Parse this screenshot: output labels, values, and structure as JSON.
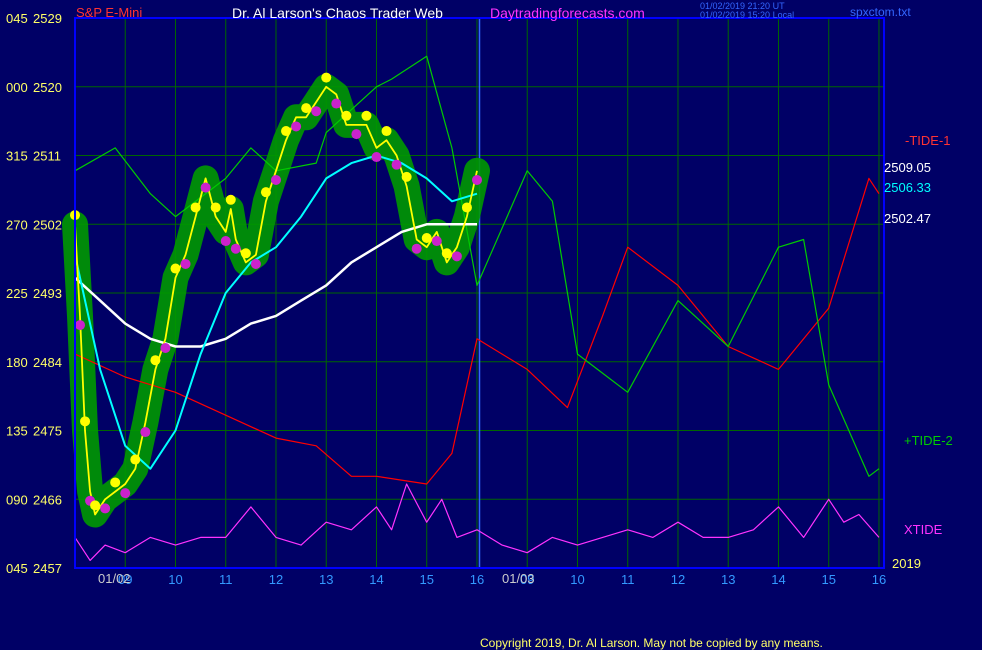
{
  "header": {
    "symbol": "S&P E-Mini",
    "title": "Dr. Al Larson's Chaos Trader Web",
    "site": "Daytradingforecasts.com",
    "timestamp1": "01/02/2019 21:20 UT",
    "timestamp2": "01/02/2019 15:20 Local",
    "filename": "spxctom.txt"
  },
  "footer": {
    "copyright": "Copyright 2019, Dr. Al Larson. May not be copied by any means.",
    "year": "2019"
  },
  "colors": {
    "background": "#000066",
    "grid": "#006600",
    "frame": "#0000ff",
    "price": "#ffff00",
    "ema_cyan": "#00ffff",
    "ema_white": "#ffffff",
    "tide1": "#ff0000",
    "tide2": "#00cc00",
    "xtide": "#ff33ff",
    "ribbon": "#009900"
  },
  "chart_data": {
    "type": "line",
    "xlabel": "",
    "ylabel": "",
    "date_labels": [
      "01/02",
      "01/03"
    ],
    "x_ticks": [
      "09",
      "10",
      "11",
      "12",
      "13",
      "14",
      "15",
      "16",
      "09",
      "10",
      "11",
      "12",
      "13",
      "14",
      "15",
      "16"
    ],
    "hours_x": [
      9,
      10,
      11,
      12,
      13,
      14,
      15,
      16,
      17,
      18,
      19,
      20,
      21,
      22,
      23,
      24
    ],
    "y_ticks_price": [
      2457,
      2466,
      2475,
      2484,
      2493,
      2502,
      2511,
      2520,
      2529
    ],
    "y_ticks_left": [
      "045",
      "090",
      "135",
      "180",
      "225",
      "270",
      "315",
      "000",
      "045"
    ],
    "ylim": [
      2457,
      2529
    ],
    "xlim": [
      8.0,
      24.1
    ],
    "right_labels": {
      "price_last": "2509.05",
      "ema_fast_last": "2506.33",
      "ema_slow_last": "2502.47",
      "tide1": "-TIDE-1",
      "tide2": "+TIDE-2",
      "xtide": "XTIDE"
    },
    "series": [
      {
        "name": "price",
        "x": [
          8.0,
          8.1,
          8.2,
          8.3,
          8.4,
          8.6,
          8.8,
          9.0,
          9.2,
          9.4,
          9.6,
          9.8,
          10.0,
          10.2,
          10.4,
          10.6,
          10.8,
          11.0,
          11.1,
          11.2,
          11.4,
          11.6,
          11.8,
          12.0,
          12.2,
          12.4,
          12.6,
          12.8,
          13.0,
          13.2,
          13.4,
          13.6,
          13.8,
          14.0,
          14.2,
          14.4,
          14.6,
          14.8,
          15.0,
          15.2,
          15.4,
          15.6,
          15.8,
          16.0
        ],
        "values": [
          2502,
          2490,
          2475,
          2467,
          2464,
          2466,
          2467,
          2468,
          2470,
          2476,
          2483,
          2487,
          2495,
          2498,
          2503,
          2508,
          2503,
          2501,
          2504,
          2500,
          2497,
          2498,
          2505,
          2509,
          2513,
          2516,
          2516,
          2518,
          2520,
          2519,
          2515,
          2515,
          2515,
          2512,
          2513,
          2511,
          2507,
          2500,
          2499,
          2501,
          2497,
          2499,
          2503,
          2509
        ]
      },
      {
        "name": "ema_fast",
        "x": [
          8.0,
          8.5,
          9.0,
          9.5,
          10.0,
          10.5,
          11.0,
          11.5,
          12.0,
          12.5,
          13.0,
          13.5,
          14.0,
          14.5,
          15.0,
          15.5,
          16.0
        ],
        "values": [
          2498,
          2483,
          2473,
          2470,
          2475,
          2485,
          2493,
          2497,
          2499,
          2503,
          2508,
          2510,
          2511,
          2510,
          2508,
          2505,
          2506
        ]
      },
      {
        "name": "ema_slow",
        "x": [
          8.0,
          8.5,
          9.0,
          9.5,
          10.0,
          10.5,
          11.0,
          11.5,
          12.0,
          12.5,
          13.0,
          13.5,
          14.0,
          14.5,
          15.0,
          15.5,
          16.0
        ],
        "values": [
          2495,
          2492,
          2489,
          2487,
          2486,
          2486,
          2487,
          2489,
          2490,
          2492,
          2494,
          2497,
          2499,
          2501,
          2502,
          2502,
          2502
        ]
      },
      {
        "name": "TIDE-1",
        "x": [
          8.0,
          9.0,
          10.0,
          11.0,
          12.0,
          12.8,
          13.5,
          14.0,
          15.0,
          15.5,
          16.0,
          17.0,
          17.8,
          18.5,
          19.0,
          20.0,
          21.0,
          22.0,
          23.0,
          23.8,
          24.0
        ],
        "values": [
          2485,
          2482,
          2480,
          2477,
          2474,
          2473,
          2469,
          2469,
          2468,
          2472,
          2487,
          2483,
          2478,
          2490,
          2499,
          2494,
          2486,
          2483,
          2491,
          2508,
          2506
        ]
      },
      {
        "name": "TIDE-2",
        "x": [
          8.0,
          8.8,
          9.5,
          10.0,
          11.0,
          11.5,
          12.0,
          12.8,
          13.0,
          14.0,
          14.3,
          15.0,
          15.5,
          16.0,
          17.0,
          17.5,
          18.0,
          19.0,
          20.0,
          21.0,
          22.0,
          22.5,
          23.0,
          23.8,
          24.0
        ],
        "values": [
          2509,
          2512,
          2506,
          2503,
          2508,
          2512,
          2509,
          2510,
          2514,
          2520,
          2521,
          2524,
          2512,
          2494,
          2509,
          2505,
          2485,
          2480,
          2492,
          2486,
          2499,
          2500,
          2481,
          2469,
          2470
        ]
      },
      {
        "name": "XTIDE",
        "x": [
          8.0,
          8.3,
          8.6,
          9.0,
          9.5,
          10.0,
          10.5,
          11.0,
          11.5,
          12.0,
          12.5,
          13.0,
          13.5,
          14.0,
          14.3,
          14.6,
          15.0,
          15.3,
          15.6,
          16.0,
          16.5,
          17.0,
          17.5,
          18.0,
          18.5,
          19.0,
          19.5,
          20.0,
          20.5,
          21.0,
          21.5,
          22.0,
          22.5,
          23.0,
          23.3,
          23.6,
          24.0
        ],
        "values": [
          2461,
          2458,
          2460,
          2459,
          2461,
          2460,
          2461,
          2461,
          2465,
          2461,
          2460,
          2463,
          2462,
          2465,
          2462,
          2468,
          2463,
          2466,
          2461,
          2462,
          2460,
          2459,
          2461,
          2460,
          2461,
          2462,
          2461,
          2463,
          2461,
          2461,
          2462,
          2465,
          2461,
          2466,
          2463,
          2464,
          2461
        ]
      }
    ]
  }
}
